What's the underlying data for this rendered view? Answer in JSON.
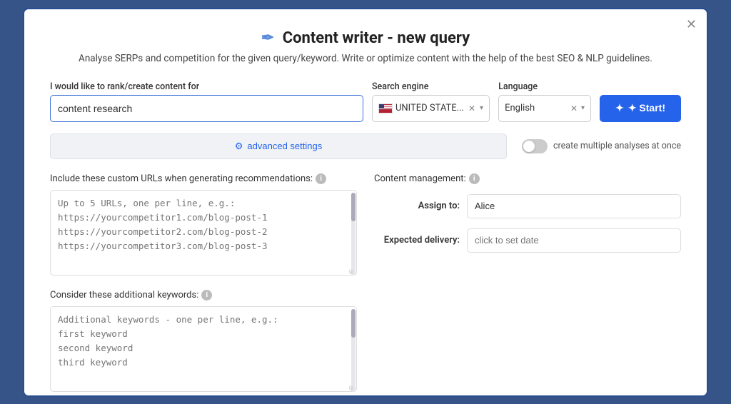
{
  "modal": {
    "title": "Content writer - new query",
    "subtitle": "Analyse SERPs and competition for the given query/keyword. Write or optimize content with the help of the best SEO & NLP guidelines."
  },
  "form": {
    "keyword_label": "I would like to rank/create content for",
    "keyword_value": "content research",
    "keyword_placeholder": "content research",
    "search_engine_label": "Search engine",
    "search_engine_value": "UNITED STATE...",
    "language_label": "Language",
    "language_value": "English",
    "start_button": "✦ Start!",
    "advanced_button": "advanced settings",
    "toggle_label": "create multiple analyses at once"
  },
  "custom_urls": {
    "label": "Include these custom URLs when generating recommendations:",
    "placeholder": "Up to 5 URLs, one per line, e.g.:\nhttps://yourcompetitor1.com/blog-post-1\nhttps://yourcompetitor2.com/blog-post-2\nhttps://yourcompetitor3.com/blog-post-3"
  },
  "additional_keywords": {
    "label": "Consider these additional keywords:",
    "placeholder": "Additional keywords - one per line, e.g.:\nfirst keyword\nsecond keyword\nthird keyword"
  },
  "content_management": {
    "label": "Content management:",
    "assign_label": "Assign to:",
    "assign_value": "Alice",
    "delivery_label": "Expected delivery:",
    "delivery_placeholder": "click to set date"
  },
  "icons": {
    "close": "✕",
    "feather": "✒",
    "info": "i",
    "settings": "⚙",
    "start": "✦"
  }
}
